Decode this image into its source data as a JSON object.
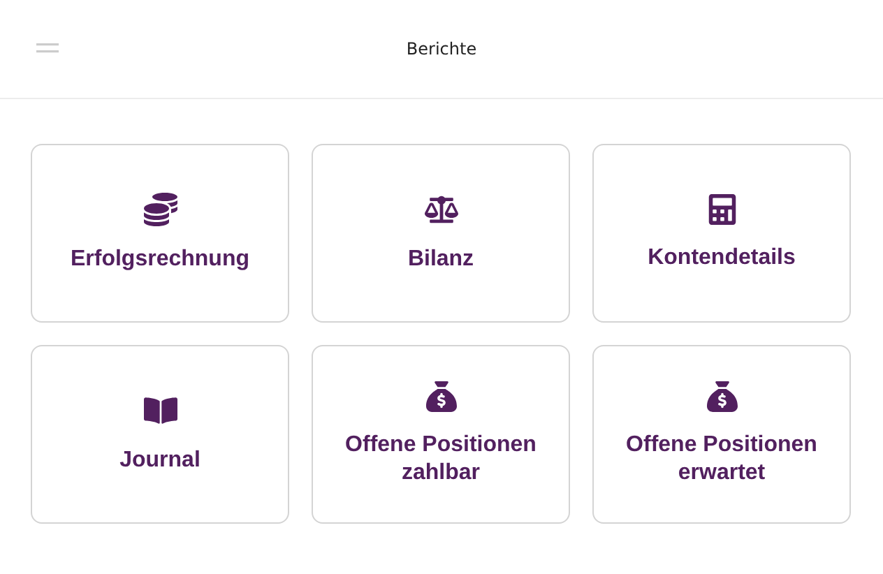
{
  "header": {
    "title": "Berichte"
  },
  "reports": [
    {
      "label": "Erfolgsrechnung"
    },
    {
      "label": "Bilanz"
    },
    {
      "label": "Kontendetails"
    },
    {
      "label": "Journal"
    },
    {
      "label": "Offene Positionen zahlbar"
    },
    {
      "label": "Offene Positionen erwartet"
    }
  ]
}
